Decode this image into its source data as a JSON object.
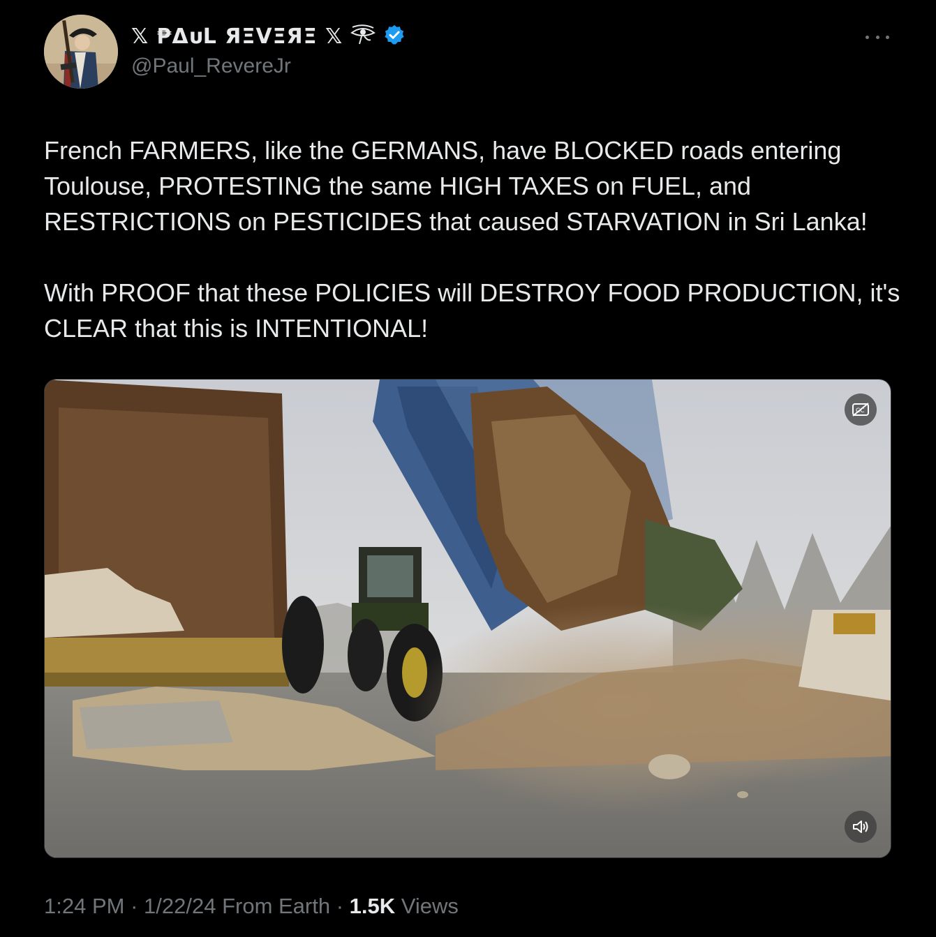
{
  "author": {
    "display_name": "𝕏 ₱ΔᴜL ЯΞVΞЯΞ 𝕏",
    "handle": "@Paul_RevereJr",
    "verified": true,
    "verified_color": "#1d9bf0"
  },
  "tweet": {
    "text": "French FARMERS, like the GERMANS, have BLOCKED roads entering Toulouse, PROTESTING the same HIGH TAXES on FUEL, and RESTRICTIONS on PESTICIDES that caused STARVATION in Sri Lanka!\n\nWith PROOF that these POLICIES will DESTROY FOOD PRODUCTION, it's CLEAR that this is INTENTIONAL!"
  },
  "media": {
    "type": "video",
    "captions_icon": "captions-off-icon",
    "volume_icon": "volume-icon"
  },
  "meta": {
    "time": "1:24 PM",
    "sep1": " · ",
    "date": "1/22/24",
    "source": " From Earth",
    "sep2": " · ",
    "views_count": "1.5K",
    "views_label": " Views"
  },
  "icons": {
    "more": "more-icon",
    "eye": "eye-of-horus-icon",
    "verified": "verified-badge-icon"
  }
}
